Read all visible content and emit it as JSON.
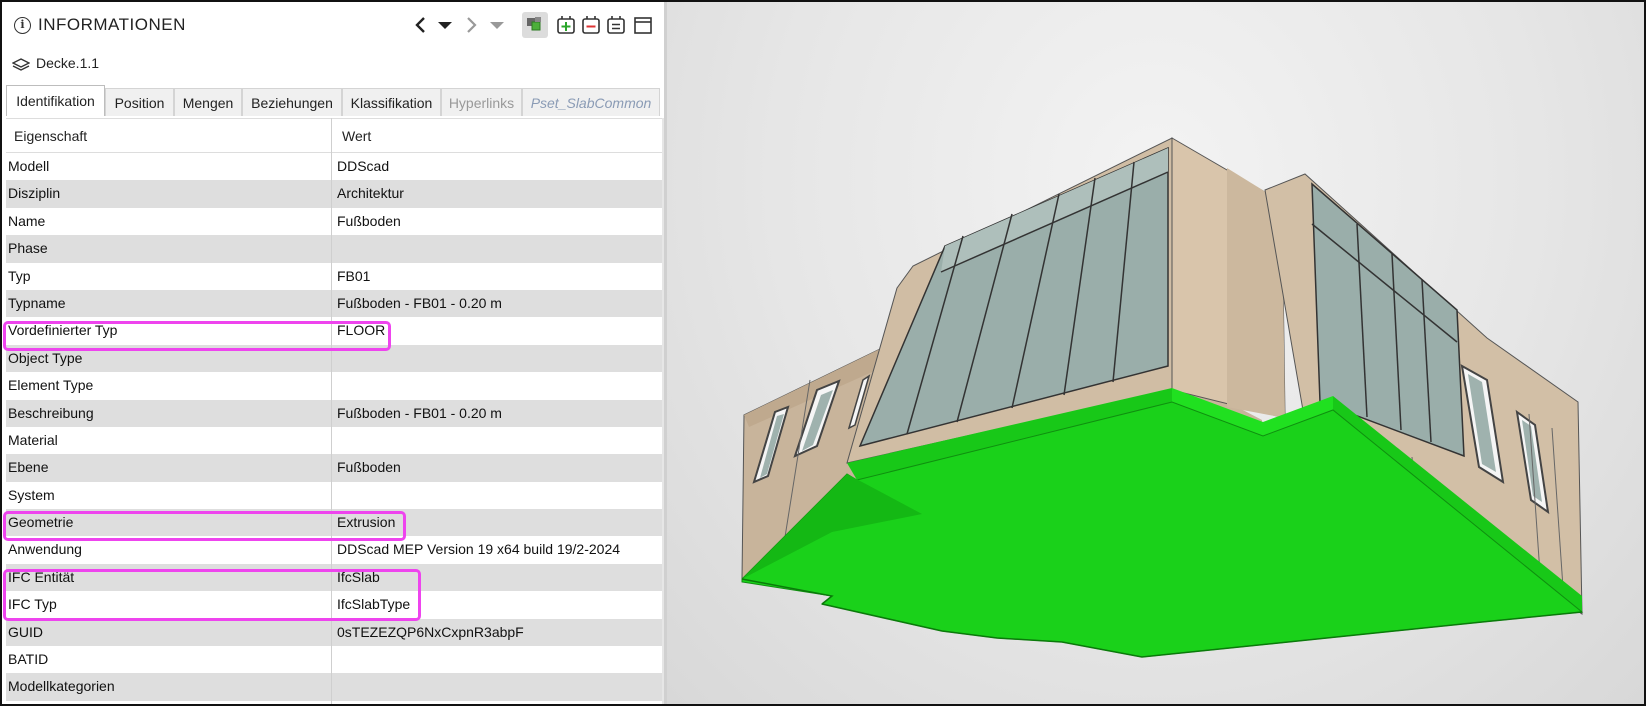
{
  "panel": {
    "title": "INFORMATIONEN",
    "entity_name": "Decke.1.1"
  },
  "tabs": [
    {
      "label": "Identifikation"
    },
    {
      "label": "Position"
    },
    {
      "label": "Mengen"
    },
    {
      "label": "Beziehungen"
    },
    {
      "label": "Klassifikation"
    },
    {
      "label": "Hyperlinks"
    },
    {
      "label": "Pset_SlabCommon"
    }
  ],
  "table": {
    "col_property": "Eigenschaft",
    "col_value": "Wert",
    "rows": [
      {
        "property": "Modell",
        "value": "DDScad"
      },
      {
        "property": "Disziplin",
        "value": "Architektur"
      },
      {
        "property": "Name",
        "value": "Fußboden"
      },
      {
        "property": "Phase",
        "value": ""
      },
      {
        "property": "Typ",
        "value": "FB01"
      },
      {
        "property": "Typname",
        "value": "Fußboden - FB01 - 0.20 m"
      },
      {
        "property": "Vordefinierter Typ",
        "value": "FLOOR"
      },
      {
        "property": "Object Type",
        "value": ""
      },
      {
        "property": "Element Type",
        "value": ""
      },
      {
        "property": "Beschreibung",
        "value": "Fußboden - FB01 - 0.20 m"
      },
      {
        "property": "Material",
        "value": ""
      },
      {
        "property": "Ebene",
        "value": "Fußboden"
      },
      {
        "property": "System",
        "value": ""
      },
      {
        "property": "Geometrie",
        "value": "Extrusion"
      },
      {
        "property": "Anwendung",
        "value": "DDScad MEP Version 19 x64 build 19/2-2024"
      },
      {
        "property": "IFC Entität",
        "value": "IfcSlab"
      },
      {
        "property": "IFC Typ",
        "value": "IfcSlabType"
      },
      {
        "property": "GUID",
        "value": "0sTEZEZQP6NxCxpnR3abpF"
      },
      {
        "property": "BATID",
        "value": ""
      },
      {
        "property": "Modellkategorien",
        "value": ""
      }
    ]
  },
  "toolbar_icons": [
    "chevron-left-icon",
    "dropdown-arrow-icon",
    "chevron-right-icon",
    "dropdown-arrow-disabled-icon",
    "select-elements-icon",
    "add-icon",
    "remove-icon",
    "list-icon",
    "window-icon"
  ],
  "colors": {
    "highlight": "#ee44ee",
    "slab_green": "#1ad11a",
    "wall_beige": "#d2bfa6",
    "glass": "#9fb2ae"
  }
}
